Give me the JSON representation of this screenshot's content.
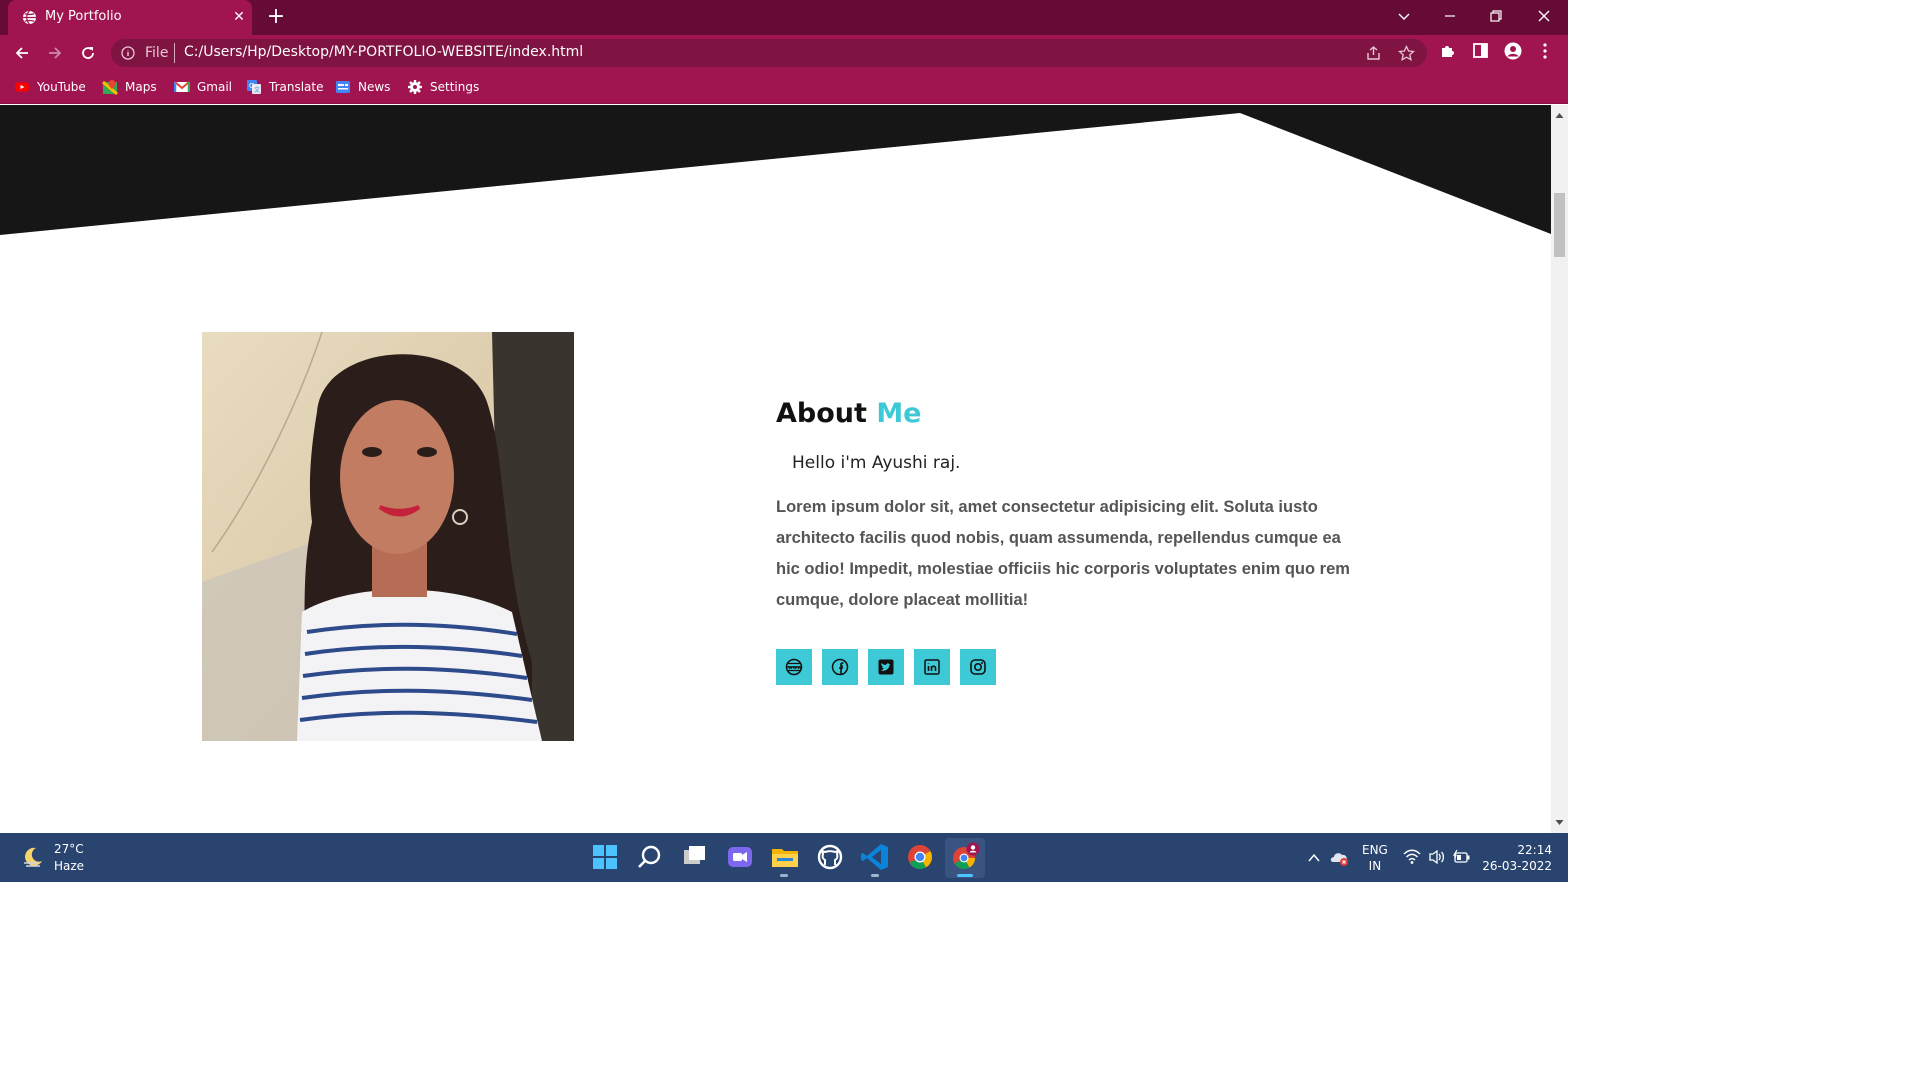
{
  "browser": {
    "tab_title": "My Portfolio",
    "omnibox": {
      "scheme_label": "File",
      "url": "C:/Users/Hp/Desktop/MY-PORTFOLIO-WEBSITE/index.html"
    },
    "bookmarks": [
      "YouTube",
      "Maps",
      "Gmail",
      "Translate",
      "News",
      "Settings"
    ],
    "theme_colors": {
      "frame": "#660b36",
      "toolbar": "#a0154f",
      "omnibox": "#7f1342"
    }
  },
  "page": {
    "about": {
      "title_main": "About",
      "title_accent": "Me",
      "greeting": "Hello i'm Ayushi raj.",
      "body": "Lorem ipsum dolor sit, amet consectetur adipisicing elit. Soluta iusto architecto facilis quod nobis, quam assumenda, repellendus cumque ea hic odio! Impedit, molestiae officiis hic corporis voluptates enim quo rem cumque, dolore placeat mollitia!",
      "social_icons": [
        "website-icon",
        "facebook-icon",
        "twitter-icon",
        "linkedin-icon",
        "instagram-icon"
      ],
      "accent_color": "#3ec9d6"
    },
    "hero_color": "#161616"
  },
  "taskbar": {
    "weather": {
      "temp": "27°C",
      "condition": "Haze"
    },
    "apps": [
      "start-icon",
      "search-icon",
      "task-view-icon",
      "chat-icon",
      "file-explorer-icon",
      "github-desktop-icon",
      "vscode-icon",
      "chrome-icon",
      "chrome-profile-icon"
    ],
    "language": {
      "line1": "ENG",
      "line2": "IN"
    },
    "clock": {
      "time": "22:14",
      "date": "26-03-2022"
    }
  }
}
